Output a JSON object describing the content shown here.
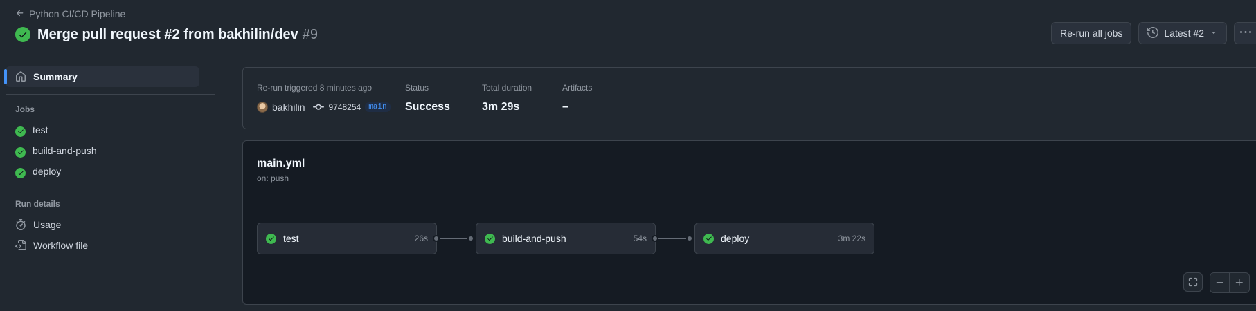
{
  "header": {
    "back_label": "Python CI/CD Pipeline",
    "title": "Merge pull request #2 from bakhilin/dev",
    "run_number": "#9",
    "actions": {
      "rerun_label": "Re-run all jobs",
      "latest_label": "Latest #2"
    }
  },
  "sidebar": {
    "summary_label": "Summary",
    "jobs_heading": "Jobs",
    "jobs": [
      {
        "label": "test"
      },
      {
        "label": "build-and-push"
      },
      {
        "label": "deploy"
      }
    ],
    "run_details_heading": "Run details",
    "usage_label": "Usage",
    "workflow_file_label": "Workflow file"
  },
  "summary": {
    "trigger_label": "Re-run triggered 8 minutes ago",
    "user": "bakhilin",
    "commit_sha": "9748254",
    "branch": "main",
    "status_label": "Status",
    "status_value": "Success",
    "duration_label": "Total duration",
    "duration_value": "3m 29s",
    "artifacts_label": "Artifacts",
    "artifacts_value": "–"
  },
  "graph": {
    "workflow_name": "main.yml",
    "workflow_trigger": "on: push",
    "jobs": [
      {
        "name": "test",
        "time": "26s"
      },
      {
        "name": "build-and-push",
        "time": "54s"
      },
      {
        "name": "deploy",
        "time": "3m 22s"
      }
    ]
  },
  "colors": {
    "background": "#212830",
    "graph_background": "#151b23",
    "success": "#3fb950",
    "accent": "#4493f8",
    "border": "#3d444d"
  }
}
